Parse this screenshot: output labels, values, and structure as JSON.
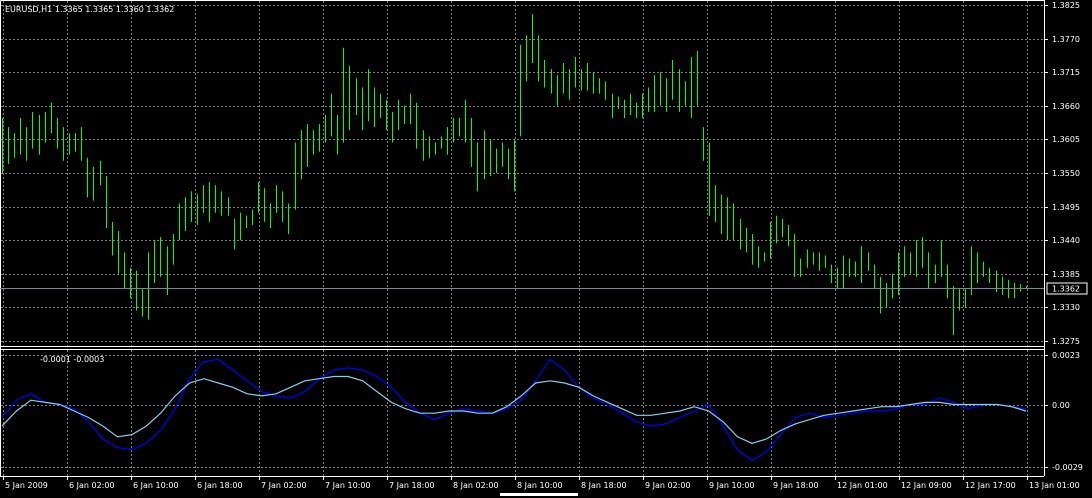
{
  "symbol_header": "EURUSD,H1  1.3365 1.3365 1.3360 1.3362",
  "indicator_header": "-0.0001 -0.0003",
  "current_price": "1.3362",
  "colors": {
    "background": "#000000",
    "grid": "#808080",
    "bars": "#00ff00",
    "macd_main": "#0000ff",
    "macd_signal": "#87ceeb",
    "axis": "#ffffff"
  },
  "price_axis_labels": [
    "1.3825",
    "1.3770",
    "1.3715",
    "1.3660",
    "1.3605",
    "1.3550",
    "1.3495",
    "1.3440",
    "1.3385",
    "1.3330",
    "1.3275"
  ],
  "indicator_axis_labels": [
    "0.0023",
    "0.00",
    "-0.0029"
  ],
  "time_axis_labels": [
    "5 Jan 2009",
    "6 Jan 02:00",
    "6 Jan 10:00",
    "6 Jan 18:00",
    "7 Jan 02:00",
    "7 Jan 10:00",
    "7 Jan 18:00",
    "8 Jan 02:00",
    "8 Jan 10:00",
    "8 Jan 18:00",
    "9 Jan 02:00",
    "9 Jan 10:00",
    "9 Jan 18:00",
    "12 Jan 01:00",
    "12 Jan 09:00",
    "12 Jan 17:00",
    "13 Jan 01:00"
  ],
  "chart_data": [
    {
      "type": "ohlc_bar",
      "symbol": "EURUSD",
      "timeframe": "H1",
      "ylim": [
        1.3275,
        1.3825
      ],
      "current_price": 1.3362,
      "bars": [
        {
          "high": 1.364,
          "low": 1.355
        },
        {
          "high": 1.3625,
          "low": 1.3565
        },
        {
          "high": 1.3615,
          "low": 1.3575
        },
        {
          "high": 1.364,
          "low": 1.358
        },
        {
          "high": 1.3625,
          "low": 1.357
        },
        {
          "high": 1.365,
          "low": 1.359
        },
        {
          "high": 1.3645,
          "low": 1.358
        },
        {
          "high": 1.365,
          "low": 1.36
        },
        {
          "high": 1.3665,
          "low": 1.3615
        },
        {
          "high": 1.364,
          "low": 1.359
        },
        {
          "high": 1.3625,
          "low": 1.357
        },
        {
          "high": 1.3615,
          "low": 1.358
        },
        {
          "high": 1.3615,
          "low": 1.3585
        },
        {
          "high": 1.3625,
          "low": 1.357
        },
        {
          "high": 1.3575,
          "low": 1.351
        },
        {
          "high": 1.356,
          "low": 1.3505
        },
        {
          "high": 1.357,
          "low": 1.353
        },
        {
          "high": 1.3545,
          "low": 1.346
        },
        {
          "high": 1.347,
          "low": 1.3415
        },
        {
          "high": 1.3455,
          "low": 1.3385
        },
        {
          "high": 1.342,
          "low": 1.336
        },
        {
          "high": 1.3395,
          "low": 1.3345
        },
        {
          "high": 1.339,
          "low": 1.3325
        },
        {
          "high": 1.336,
          "low": 1.3315
        },
        {
          "high": 1.342,
          "low": 1.331
        },
        {
          "high": 1.344,
          "low": 1.337
        },
        {
          "high": 1.3445,
          "low": 1.338
        },
        {
          "high": 1.343,
          "low": 1.335
        },
        {
          "high": 1.345,
          "low": 1.34
        },
        {
          "high": 1.35,
          "low": 1.344
        },
        {
          "high": 1.351,
          "low": 1.3455
        },
        {
          "high": 1.352,
          "low": 1.347
        },
        {
          "high": 1.3515,
          "low": 1.3465
        },
        {
          "high": 1.353,
          "low": 1.3485
        },
        {
          "high": 1.3535,
          "low": 1.347
        },
        {
          "high": 1.353,
          "low": 1.3485
        },
        {
          "high": 1.352,
          "low": 1.348
        },
        {
          "high": 1.351,
          "low": 1.348
        },
        {
          "high": 1.3475,
          "low": 1.3425
        },
        {
          "high": 1.3485,
          "low": 1.344
        },
        {
          "high": 1.348,
          "low": 1.346
        },
        {
          "high": 1.349,
          "low": 1.3465
        },
        {
          "high": 1.3535,
          "low": 1.3485
        },
        {
          "high": 1.3525,
          "low": 1.347
        },
        {
          "high": 1.35,
          "low": 1.346
        },
        {
          "high": 1.353,
          "low": 1.3485
        },
        {
          "high": 1.352,
          "low": 1.347
        },
        {
          "high": 1.35,
          "low": 1.345
        },
        {
          "high": 1.36,
          "low": 1.349
        },
        {
          "high": 1.362,
          "low": 1.354
        },
        {
          "high": 1.363,
          "low": 1.356
        },
        {
          "high": 1.362,
          "low": 1.358
        },
        {
          "high": 1.363,
          "low": 1.3585
        },
        {
          "high": 1.3645,
          "low": 1.36
        },
        {
          "high": 1.368,
          "low": 1.361
        },
        {
          "high": 1.3645,
          "low": 1.358
        },
        {
          "high": 1.3755,
          "low": 1.36
        },
        {
          "high": 1.3725,
          "low": 1.362
        },
        {
          "high": 1.3705,
          "low": 1.3645
        },
        {
          "high": 1.369,
          "low": 1.362
        },
        {
          "high": 1.372,
          "low": 1.3635
        },
        {
          "high": 1.369,
          "low": 1.3625
        },
        {
          "high": 1.368,
          "low": 1.364
        },
        {
          "high": 1.367,
          "low": 1.362
        },
        {
          "high": 1.365,
          "low": 1.36
        },
        {
          "high": 1.367,
          "low": 1.362
        },
        {
          "high": 1.366,
          "low": 1.363
        },
        {
          "high": 1.368,
          "low": 1.363
        },
        {
          "high": 1.3665,
          "low": 1.359
        },
        {
          "high": 1.362,
          "low": 1.357
        },
        {
          "high": 1.361,
          "low": 1.3575
        },
        {
          "high": 1.36,
          "low": 1.358
        },
        {
          "high": 1.361,
          "low": 1.359
        },
        {
          "high": 1.3625,
          "low": 1.358
        },
        {
          "high": 1.364,
          "low": 1.36
        },
        {
          "high": 1.364,
          "low": 1.361
        },
        {
          "high": 1.367,
          "low": 1.36
        },
        {
          "high": 1.364,
          "low": 1.356
        },
        {
          "high": 1.36,
          "low": 1.352
        },
        {
          "high": 1.362,
          "low": 1.354
        },
        {
          "high": 1.3605,
          "low": 1.3545
        },
        {
          "high": 1.359,
          "low": 1.355
        },
        {
          "high": 1.36,
          "low": 1.356
        },
        {
          "high": 1.359,
          "low": 1.354
        },
        {
          "high": 1.3605,
          "low": 1.352
        },
        {
          "high": 1.376,
          "low": 1.361
        },
        {
          "high": 1.3775,
          "low": 1.37
        },
        {
          "high": 1.381,
          "low": 1.373
        },
        {
          "high": 1.3775,
          "low": 1.37
        },
        {
          "high": 1.3735,
          "low": 1.369
        },
        {
          "high": 1.372,
          "low": 1.368
        },
        {
          "high": 1.371,
          "low": 1.366
        },
        {
          "high": 1.373,
          "low": 1.368
        },
        {
          "high": 1.372,
          "low": 1.367
        },
        {
          "high": 1.374,
          "low": 1.369
        },
        {
          "high": 1.372,
          "low": 1.3685
        },
        {
          "high": 1.373,
          "low": 1.3685
        },
        {
          "high": 1.3715,
          "low": 1.368
        },
        {
          "high": 1.3705,
          "low": 1.368
        },
        {
          "high": 1.37,
          "low": 1.367
        },
        {
          "high": 1.368,
          "low": 1.364
        },
        {
          "high": 1.3675,
          "low": 1.3655
        },
        {
          "high": 1.367,
          "low": 1.364
        },
        {
          "high": 1.368,
          "low": 1.3645
        },
        {
          "high": 1.3665,
          "low": 1.364
        },
        {
          "high": 1.368,
          "low": 1.364
        },
        {
          "high": 1.369,
          "low": 1.365
        },
        {
          "high": 1.371,
          "low": 1.365
        },
        {
          "high": 1.3715,
          "low": 1.366
        },
        {
          "high": 1.3705,
          "low": 1.365
        },
        {
          "high": 1.3735,
          "low": 1.367
        },
        {
          "high": 1.372,
          "low": 1.365
        },
        {
          "high": 1.37,
          "low": 1.366
        },
        {
          "high": 1.374,
          "low": 1.364
        },
        {
          "high": 1.375,
          "low": 1.366
        },
        {
          "high": 1.3625,
          "low": 1.357
        },
        {
          "high": 1.36,
          "low": 1.348
        },
        {
          "high": 1.353,
          "low": 1.347
        },
        {
          "high": 1.3515,
          "low": 1.345
        },
        {
          "high": 1.351,
          "low": 1.344
        },
        {
          "high": 1.35,
          "low": 1.344
        },
        {
          "high": 1.3475,
          "low": 1.3425
        },
        {
          "high": 1.346,
          "low": 1.342
        },
        {
          "high": 1.345,
          "low": 1.34
        },
        {
          "high": 1.343,
          "low": 1.3395
        },
        {
          "high": 1.342,
          "low": 1.3405
        },
        {
          "high": 1.347,
          "low": 1.341
        },
        {
          "high": 1.348,
          "low": 1.3435
        },
        {
          "high": 1.3475,
          "low": 1.3445
        },
        {
          "high": 1.3465,
          "low": 1.343
        },
        {
          "high": 1.345,
          "low": 1.338
        },
        {
          "high": 1.341,
          "low": 1.338
        },
        {
          "high": 1.3425,
          "low": 1.3395
        },
        {
          "high": 1.342,
          "low": 1.34
        },
        {
          "high": 1.342,
          "low": 1.339
        },
        {
          "high": 1.3415,
          "low": 1.3395
        },
        {
          "high": 1.34,
          "low": 1.337
        },
        {
          "high": 1.3395,
          "low": 1.336
        },
        {
          "high": 1.3415,
          "low": 1.336
        },
        {
          "high": 1.341,
          "low": 1.338
        },
        {
          "high": 1.3405,
          "low": 1.338
        },
        {
          "high": 1.343,
          "low": 1.337
        },
        {
          "high": 1.342,
          "low": 1.339
        },
        {
          "high": 1.34,
          "low": 1.336
        },
        {
          "high": 1.338,
          "low": 1.332
        },
        {
          "high": 1.337,
          "low": 1.333
        },
        {
          "high": 1.3385,
          "low": 1.3345
        },
        {
          "high": 1.342,
          "low": 1.335
        },
        {
          "high": 1.343,
          "low": 1.338
        },
        {
          "high": 1.342,
          "low": 1.3385
        },
        {
          "high": 1.344,
          "low": 1.338
        },
        {
          "high": 1.3445,
          "low": 1.3395
        },
        {
          "high": 1.342,
          "low": 1.336
        },
        {
          "high": 1.34,
          "low": 1.337
        },
        {
          "high": 1.344,
          "low": 1.338
        },
        {
          "high": 1.34,
          "low": 1.3345
        },
        {
          "high": 1.3365,
          "low": 1.3285
        },
        {
          "high": 1.336,
          "low": 1.3325
        },
        {
          "high": 1.336,
          "low": 1.333
        },
        {
          "high": 1.343,
          "low": 1.335
        },
        {
          "high": 1.342,
          "low": 1.337
        },
        {
          "high": 1.3405,
          "low": 1.338
        },
        {
          "high": 1.3395,
          "low": 1.337
        },
        {
          "high": 1.339,
          "low": 1.3355
        },
        {
          "high": 1.338,
          "low": 1.335
        },
        {
          "high": 1.3375,
          "low": 1.3345
        },
        {
          "high": 1.337,
          "low": 1.3345
        },
        {
          "high": 1.3368,
          "low": 1.3356
        },
        {
          "high": 1.3365,
          "low": 1.336
        }
      ]
    },
    {
      "type": "line",
      "indicator": "MACD",
      "ylim": [
        -0.0029,
        0.0023
      ],
      "series": [
        {
          "values": [
            -0.0006,
            0.0002,
            0.0005,
            0.0001,
            0.0,
            -0.0002,
            -0.0008,
            -0.0016,
            -0.002,
            -0.0021,
            -0.0018,
            -0.0012,
            -0.0002,
            0.0012,
            0.002,
            0.0021,
            0.0016,
            0.0011,
            0.0006,
            0.0004,
            0.0003,
            0.0006,
            0.0012,
            0.0016,
            0.0017,
            0.0016,
            0.0013,
            0.0008,
            0.0001,
            -0.0004,
            -0.0007,
            -0.0004,
            -0.0002,
            -0.0003,
            -0.0004,
            -0.0002,
            0.0002,
            0.0011,
            0.0021,
            0.0016,
            0.0008,
            0.0003,
            0.0,
            -0.0004,
            -0.0008,
            -0.001,
            -0.0009,
            -0.0006,
            -0.0003,
            0.0,
            -0.001,
            -0.0021,
            -0.0026,
            -0.0022,
            -0.0014,
            -0.0006,
            -0.0004,
            -0.0006,
            -0.0005,
            -0.0004,
            -0.0003,
            -0.0003,
            -0.0002,
            0.0,
            0.0,
            0.0003,
            0.0001,
            -0.0002,
            0.0,
            0.0,
            -0.0001,
            -0.0002
          ]
        },
        {
          "values": [
            -0.001,
            -0.0003,
            0.0002,
            0.0001,
            0.0,
            -0.0003,
            -0.0006,
            -0.001,
            -0.0015,
            -0.0014,
            -0.001,
            -0.0004,
            0.0004,
            0.001,
            0.0012,
            0.001,
            0.0008,
            0.0005,
            0.0004,
            0.0005,
            0.0008,
            0.0011,
            0.0012,
            0.0013,
            0.0013,
            0.0011,
            0.0006,
            0.0001,
            -0.0002,
            -0.0004,
            -0.0004,
            -0.0003,
            -0.0003,
            -0.0004,
            -0.0004,
            -0.0001,
            0.0004,
            0.001,
            0.0011,
            0.001,
            0.0008,
            0.0004,
            0.0001,
            -0.0002,
            -0.0005,
            -0.0005,
            -0.0004,
            -0.0003,
            -0.0001,
            -0.0003,
            -0.0008,
            -0.0015,
            -0.0018,
            -0.0016,
            -0.0012,
            -0.0009,
            -0.0007,
            -0.0005,
            -0.0004,
            -0.0003,
            -0.0002,
            -0.0001,
            -0.0001,
            0.0,
            0.0001,
            0.0001,
            0.0,
            0.0,
            0.0,
            0.0,
            -0.0001,
            -0.0003
          ]
        }
      ]
    }
  ]
}
